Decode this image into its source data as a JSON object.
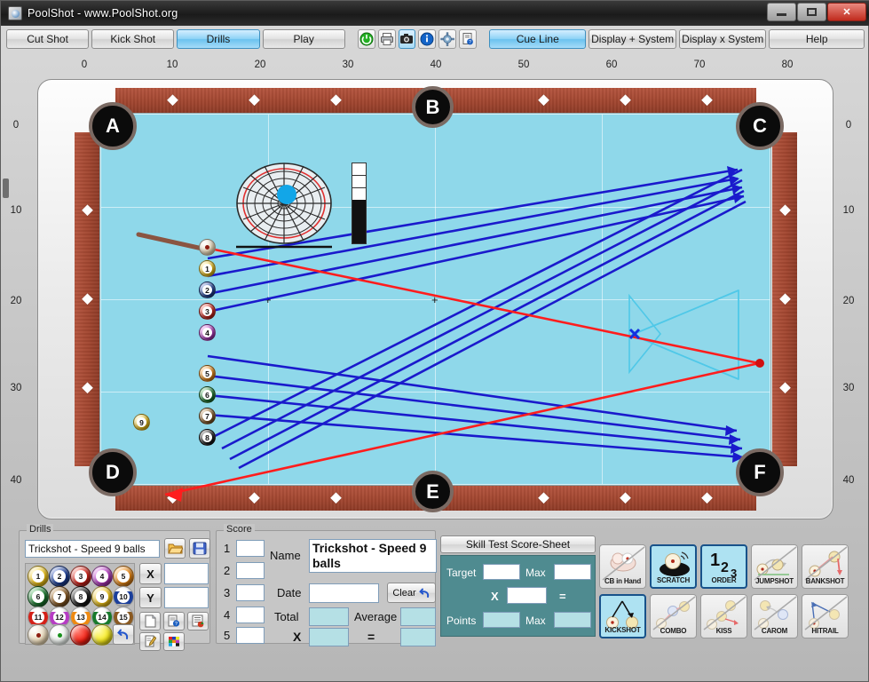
{
  "window": {
    "title": "PoolShot - www.PoolShot.org",
    "icon": "poolshot-app-icon",
    "buttons": {
      "minimize": "–",
      "maximize": "☐",
      "close": "✕"
    }
  },
  "toolbar": {
    "modes": [
      {
        "label": "Cut Shot",
        "active": false
      },
      {
        "label": "Kick Shot",
        "active": false
      },
      {
        "label": "Drills",
        "active": true
      },
      {
        "label": "Play",
        "active": false
      }
    ],
    "icons": [
      {
        "name": "power-icon",
        "glyph": "⏻",
        "color": "#19a419",
        "selected": false
      },
      {
        "name": "printer-icon",
        "glyph": "⎙",
        "color": "#4a4a4a",
        "selected": false
      },
      {
        "name": "camera-icon",
        "glyph": "▣",
        "color": "#1c1c1c",
        "selected": true
      },
      {
        "name": "info-icon",
        "glyph": "i",
        "color": "#1060c0",
        "selected": false
      },
      {
        "name": "settings-icon",
        "glyph": "⚙",
        "color": "#5a7fa5",
        "selected": false
      },
      {
        "name": "help-doc-icon",
        "glyph": "⍰",
        "color": "#2255aa",
        "selected": false
      }
    ],
    "cue_line": {
      "label": "Cue Line",
      "active": true
    },
    "display_plus": "Display + System",
    "display_x": "Display x System",
    "help": "Help"
  },
  "rulers": {
    "top": [
      "0",
      "10",
      "20",
      "30",
      "40",
      "50",
      "60",
      "70",
      "80"
    ],
    "left": [
      "0",
      "10",
      "20",
      "30",
      "40"
    ],
    "right": [
      "0",
      "10",
      "20",
      "30",
      "40"
    ]
  },
  "table": {
    "pockets": [
      {
        "label": "A",
        "position": "top-left"
      },
      {
        "label": "B",
        "position": "top-middle"
      },
      {
        "label": "C",
        "position": "top-right"
      },
      {
        "label": "D",
        "position": "bottom-left"
      },
      {
        "label": "E",
        "position": "bottom-middle"
      },
      {
        "label": "F",
        "position": "bottom-right"
      }
    ],
    "felt_color": "#8fd8ea",
    "rail_color": "#a0452f",
    "balls": [
      {
        "id": "cue",
        "label": "",
        "color": "#f4ead0",
        "striped": false
      },
      {
        "id": "1",
        "label": "1",
        "color": "#f2c518",
        "striped": false
      },
      {
        "id": "2",
        "label": "2",
        "color": "#1b3f9b",
        "striped": false
      },
      {
        "id": "3",
        "label": "3",
        "color": "#d42017",
        "striped": false
      },
      {
        "id": "4",
        "label": "4",
        "color": "#b63cc4",
        "striped": false
      },
      {
        "id": "5",
        "label": "5",
        "color": "#ee8a12",
        "striped": false
      },
      {
        "id": "6",
        "label": "6",
        "color": "#187a2c",
        "striped": false
      },
      {
        "id": "7",
        "label": "7",
        "color": "#8a5a22",
        "striped": false
      },
      {
        "id": "8",
        "label": "8",
        "color": "#171717",
        "striped": false
      },
      {
        "id": "9",
        "label": "9",
        "color": "#f2c518",
        "striped": true
      }
    ],
    "aim_widget": {
      "name": "spin-target-widget",
      "spin_color": "#12a6e8"
    },
    "speed_bar": {
      "name": "speed-meter",
      "fill_percent": 55
    },
    "target_marker": {
      "name": "target-x-marker",
      "color": "#1232e0"
    },
    "rack_outline": {
      "name": "rack-triangle-outline",
      "color": "#4fc8e8"
    },
    "cue_line_color": "#ff1d1d",
    "path_line_color": "#1a1acc"
  },
  "drills": {
    "legend": "Drills",
    "selected": "Trickshot - Speed 9 balls",
    "open_button": "open-drill-icon",
    "save_button": "save-drill-icon",
    "ball_rows": [
      [
        {
          "n": "1",
          "c": "#f2c518",
          "s": false
        },
        {
          "n": "2",
          "c": "#1b3f9b",
          "s": false
        },
        {
          "n": "3",
          "c": "#d42017",
          "s": false
        },
        {
          "n": "4",
          "c": "#b63cc4",
          "s": false
        },
        {
          "n": "5",
          "c": "#ee8a12",
          "s": false
        }
      ],
      [
        {
          "n": "6",
          "c": "#187a2c",
          "s": false
        },
        {
          "n": "7",
          "c": "#8a5a22",
          "s": false
        },
        {
          "n": "8",
          "c": "#171717",
          "s": false
        },
        {
          "n": "9",
          "c": "#f2c518",
          "s": false
        },
        {
          "n": "10",
          "c": "#1b3f9b",
          "s": true
        }
      ],
      [
        {
          "n": "11",
          "c": "#d42017",
          "s": true
        },
        {
          "n": "12",
          "c": "#b63cc4",
          "s": true
        },
        {
          "n": "13",
          "c": "#ee8a12",
          "s": true
        },
        {
          "n": "14",
          "c": "#187a2c",
          "s": true
        },
        {
          "n": "15",
          "c": "#8a5a22",
          "s": true
        }
      ]
    ],
    "special_balls": [
      {
        "name": "cue-ball-swatch",
        "color": "#f4ead0"
      },
      {
        "name": "ghost-ball-swatch",
        "color": "#eef3ef"
      },
      {
        "name": "red-ball-swatch",
        "color": "#f21d10"
      },
      {
        "name": "yellow-ball-swatch",
        "color": "#f5e918"
      }
    ],
    "undo_button": "undo-icon",
    "x_button": "X",
    "y_button": "Y",
    "x_value": "",
    "y_value": "",
    "tool_icons": [
      {
        "name": "new-page-icon",
        "glyph": "☐"
      },
      {
        "name": "doc-help-icon",
        "glyph": "⍰"
      },
      {
        "name": "list-color-icon",
        "glyph": "☰"
      },
      {
        "name": "edit-note-icon",
        "glyph": "✎"
      },
      {
        "name": "palette-icon",
        "glyph": "▦"
      }
    ]
  },
  "score": {
    "legend": "Score",
    "rows": [
      "1",
      "2",
      "3",
      "4",
      "5"
    ],
    "row_values": [
      "",
      "",
      "",
      "",
      ""
    ],
    "name_label": "Name",
    "name_value": "Trickshot - Speed 9 balls",
    "date_label": "Date",
    "date_value": "",
    "clear_label": "Clear",
    "total_label": "Total",
    "total_value": "",
    "average_label": "Average",
    "average_value": "",
    "x_label": "X",
    "x_value": "",
    "equals_label": "=",
    "result_value": ""
  },
  "skill_test": {
    "title": "Skill Test Score-Sheet",
    "target_label": "Target",
    "target_value": "",
    "max1_label": "Max",
    "max1_value": "",
    "x_label": "X",
    "multiplier_value": "",
    "equals_label": "=",
    "points_label": "Points",
    "points_value": "",
    "max2_label": "Max",
    "max2_value": ""
  },
  "shot_types": [
    {
      "label": "CB in Hand",
      "icon": "cb-in-hand-icon",
      "active": false
    },
    {
      "label": "SCRATCH",
      "icon": "scratch-icon",
      "active": true
    },
    {
      "label": "ORDER",
      "icon": "order-icon",
      "active": true
    },
    {
      "label": "JUMPSHOT",
      "icon": "jumpshot-icon",
      "active": false
    },
    {
      "label": "BANKSHOT",
      "icon": "bankshot-icon",
      "active": false
    },
    {
      "label": "KICKSHOT",
      "icon": "kickshot-icon",
      "active": true
    },
    {
      "label": "COMBO",
      "icon": "combo-icon",
      "active": false
    },
    {
      "label": "KISS",
      "icon": "kiss-icon",
      "active": false
    },
    {
      "label": "CAROM",
      "icon": "carom-icon",
      "active": false
    },
    {
      "label": "HITRAIL",
      "icon": "hitrail-icon",
      "active": false
    }
  ],
  "order_icon_digits": [
    "1",
    "2",
    "3"
  ]
}
